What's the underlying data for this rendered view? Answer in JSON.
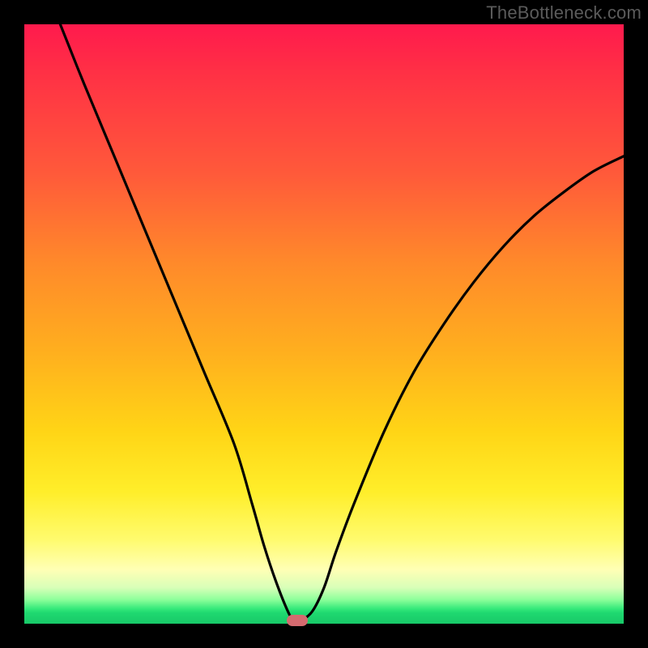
{
  "watermark": "TheBottleneck.com",
  "chart_data": {
    "type": "line",
    "title": "",
    "xlabel": "",
    "ylabel": "",
    "xlim": [
      0,
      100
    ],
    "ylim": [
      0,
      100
    ],
    "grid": false,
    "legend": false,
    "series": [
      {
        "name": "bottleneck-curve",
        "x": [
          6,
          10,
          15,
          20,
          25,
          30,
          35,
          38,
          40,
          42,
          44,
          45,
          46,
          48,
          50,
          52,
          55,
          60,
          65,
          70,
          75,
          80,
          85,
          90,
          95,
          100
        ],
        "y": [
          100,
          90,
          78,
          66,
          54,
          42,
          30,
          20,
          13,
          7,
          2,
          0.5,
          0.5,
          2,
          6,
          12,
          20,
          32,
          42,
          50,
          57,
          63,
          68,
          72,
          75.5,
          78
        ]
      }
    ],
    "annotations": [
      {
        "name": "optimal-marker",
        "x": 45.5,
        "y": 0.5
      }
    ],
    "background_gradient": {
      "top": "#ff1a4d",
      "mid": "#ffd516",
      "bottom": "#18c968"
    }
  }
}
